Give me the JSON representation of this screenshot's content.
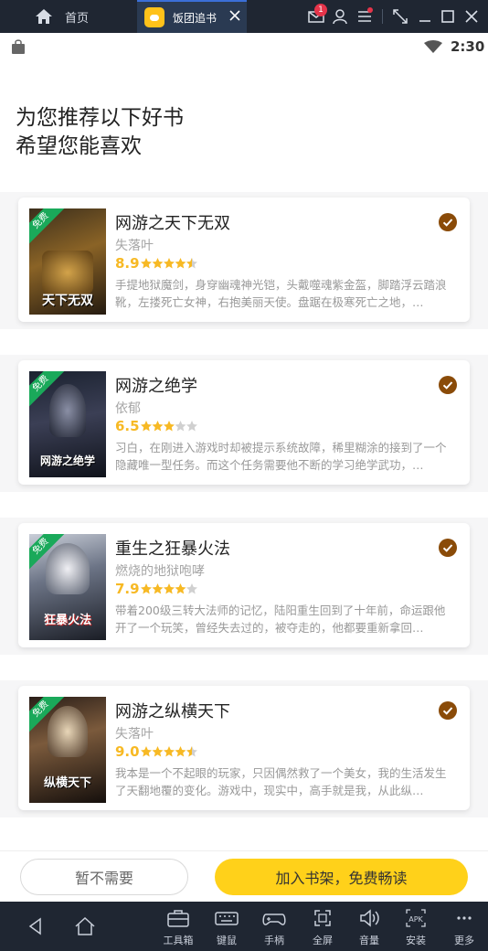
{
  "emulator": {
    "home_tab_label": "首页",
    "app_tab_label": "饭团追书",
    "mail_badge": "1",
    "tools": [
      {
        "label": "工具箱",
        "icon": "toolbox-icon"
      },
      {
        "label": "键鼠",
        "icon": "keyboard-icon"
      },
      {
        "label": "手柄",
        "icon": "gamepad-icon"
      },
      {
        "label": "全屏",
        "icon": "fullscreen-icon"
      },
      {
        "label": "音量",
        "icon": "volume-icon"
      },
      {
        "label": "安装",
        "icon": "apk-icon"
      },
      {
        "label": "更多",
        "icon": "more-icon"
      }
    ],
    "apk_text": "APK"
  },
  "status_bar": {
    "time": "2:30"
  },
  "header": {
    "line1": "为您推荐以下好书",
    "line2": "希望您能喜欢"
  },
  "books": [
    {
      "title": "网游之天下无双",
      "author": "失落叶",
      "score": "8.9",
      "rating_stars": 4.5,
      "description": "手提地狱魔剑，身穿幽魂神光铠，头戴噬魂紫金盔，脚踏浮云踏浪靴，左搂死亡女神，右抱美丽天使。盘踞在极寒死亡之地，…",
      "free_tag": "免费",
      "cover_text": "天下无双",
      "selected": true
    },
    {
      "title": "网游之绝学",
      "author": "依郁",
      "score": "6.5",
      "rating_stars": 3,
      "description": "习白，在刚进入游戏时却被提示系统故障，稀里糊涂的接到了一个隐藏唯一型任务。而这个任务需要他不断的学习绝学武功，…",
      "free_tag": "免费",
      "cover_text": "网游之绝学",
      "selected": true
    },
    {
      "title": "重生之狂暴火法",
      "author": "燃烧的地狱咆哮",
      "score": "7.9",
      "rating_stars": 4,
      "description": "带着200级三转大法师的记忆，陆阳重生回到了十年前，命运跟他开了一个玩笑，曾经失去过的，被夺走的，他都要重新拿回…",
      "free_tag": "免费",
      "cover_text": "狂暴火法",
      "selected": true
    },
    {
      "title": "网游之纵横天下",
      "author": "失落叶",
      "score": "9.0",
      "rating_stars": 4.5,
      "description": "我本是一个不起眼的玩家，只因偶然救了一个美女，我的生活发生了天翻地覆的变化。游戏中，现实中，高手就是我，从此纵…",
      "free_tag": "免费",
      "cover_text": "纵横天下",
      "selected": true
    }
  ],
  "actions": {
    "decline": "暂不需要",
    "accept": "加入书架，免费畅读"
  },
  "colors": {
    "accent": "#ffd11a",
    "check": "#8a4b08",
    "score": "#f7b924",
    "free_tag": "#1aa95a"
  }
}
